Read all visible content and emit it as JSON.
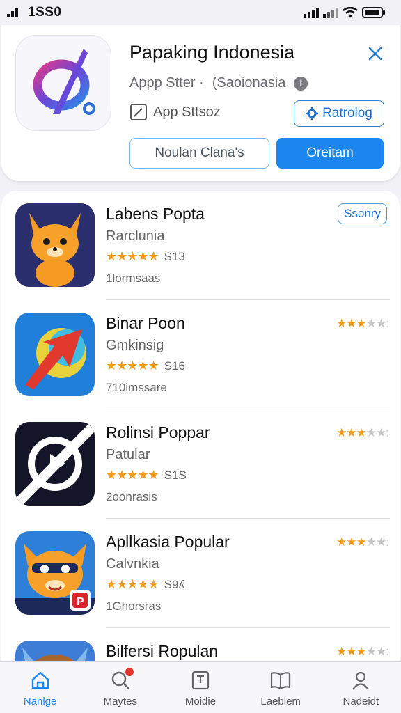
{
  "status_bar": {
    "time": "1SS0"
  },
  "header": {
    "title": "Papaking Indonesia",
    "subtitle_store": "Appp Stter ·",
    "subtitle_country": "(Saoionasia",
    "store_label": "App Sttsoz",
    "rating_button": "Ratrolog",
    "secondary_button": "Noulan Clana's",
    "primary_button": "Oreitam"
  },
  "apps": [
    {
      "name": "Labens Popta",
      "category": "Rarclunia",
      "stars": "★★★★★",
      "price": "S13",
      "downloads": "1lormsaas",
      "badge": "Ssonry",
      "right_rating": ""
    },
    {
      "name": "Binar Poon",
      "category": "Gmkinsig",
      "stars": "★★★★★",
      "price": "S16",
      "downloads": "710imssare",
      "badge": "",
      "right_rating": "★★★★★:"
    },
    {
      "name": "Rolinsi Poppar",
      "category": "Patular",
      "stars": "★★★★★",
      "price": "S1S",
      "downloads": "2oonrasis",
      "badge": "",
      "right_rating": "★★★★★:"
    },
    {
      "name": "Apllkasia Popular",
      "category": "Calvnkia",
      "stars": "★★★★★",
      "price": "S9ʎ",
      "downloads": "1Ghorsras",
      "badge": "",
      "right_rating": "★★★★★:"
    },
    {
      "name": "Bilfersi Ropulan",
      "category": "",
      "stars": "",
      "price": "",
      "downloads": "",
      "badge": "",
      "right_rating": "★★★★★:"
    }
  ],
  "tabs": [
    {
      "label": "Nanlge",
      "icon": "home-icon",
      "active": true
    },
    {
      "label": "Maytes",
      "icon": "search-icon",
      "active": false
    },
    {
      "label": "Moidie",
      "icon": "document-icon",
      "active": false
    },
    {
      "label": "Laeblem",
      "icon": "book-icon",
      "active": false
    },
    {
      "label": "Nadeidt",
      "icon": "person-icon",
      "active": false
    }
  ],
  "colors": {
    "accent": "#1a86ee",
    "star": "#f29a1a",
    "background": "#f2f2f6"
  }
}
